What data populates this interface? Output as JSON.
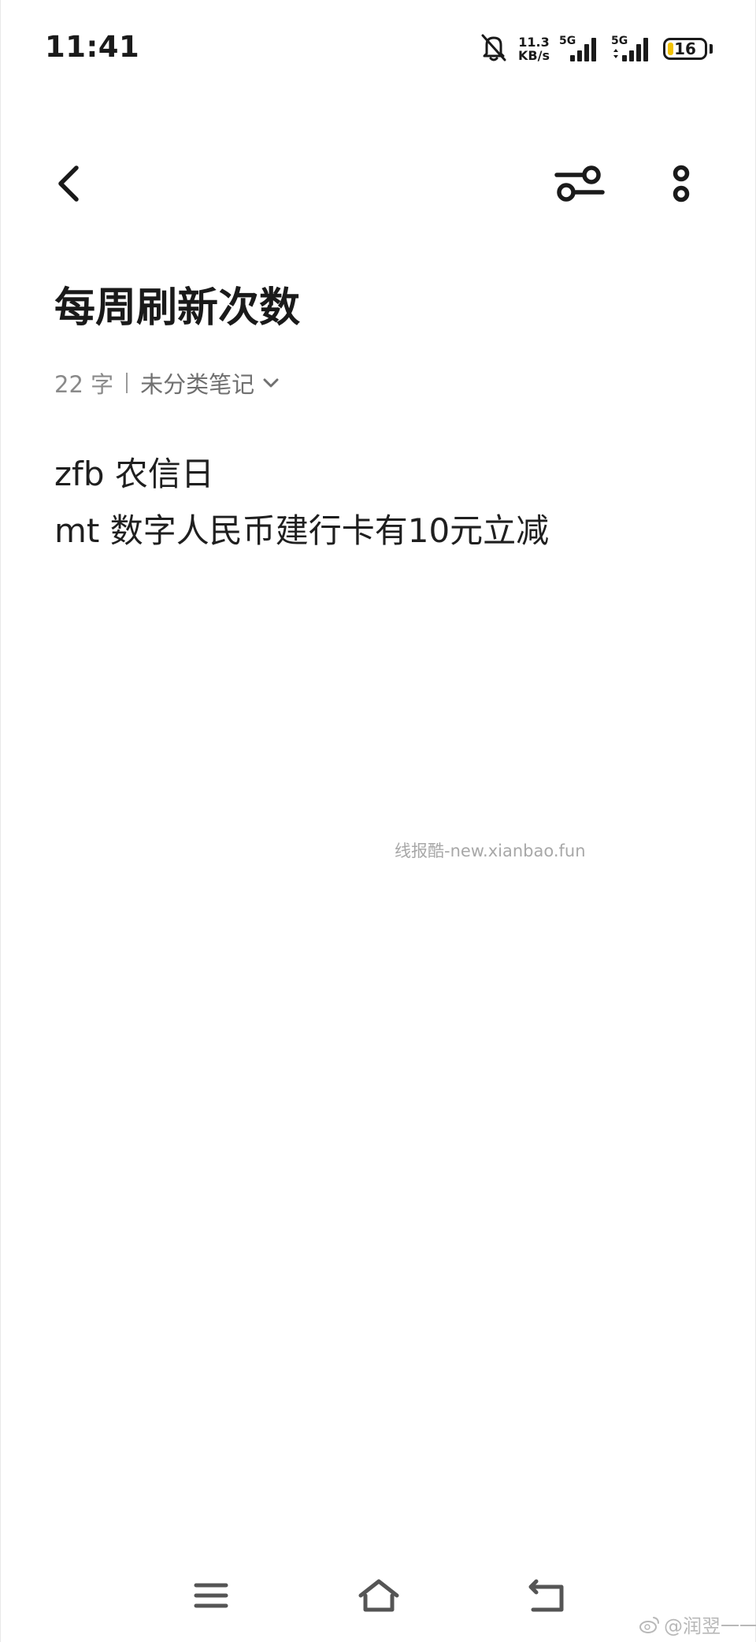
{
  "status_bar": {
    "time": "11:41",
    "net_speed_value": "11.3",
    "net_speed_unit": "KB/s",
    "sim1_label": "5G",
    "sim2_label": "5G",
    "battery_level": "16",
    "battery_percent": 16,
    "icons": [
      "bell-off-icon",
      "signal-icon",
      "signal-icon",
      "battery-icon"
    ]
  },
  "toolbar": {
    "icons": [
      "back-arrow-icon",
      "tune-icon",
      "more-vertical-icon"
    ]
  },
  "note": {
    "title": "每周刷新次数",
    "word_count": "22 字",
    "category": "未分类笔记",
    "lines": [
      "zfb 农信日",
      "mt 数字人民币建行卡有10元立减"
    ]
  },
  "watermark": "线报酷-new.xianbao.fun",
  "nav_bar": {
    "icons": [
      "menu-icon",
      "home-icon",
      "return-icon"
    ]
  },
  "weibo_mark": "@润翌一一",
  "colors": {
    "text_primary": "#1a1a1a",
    "text_secondary": "#8a8a8a",
    "battery_fill": "#f2c200",
    "background": "#ffffff"
  }
}
